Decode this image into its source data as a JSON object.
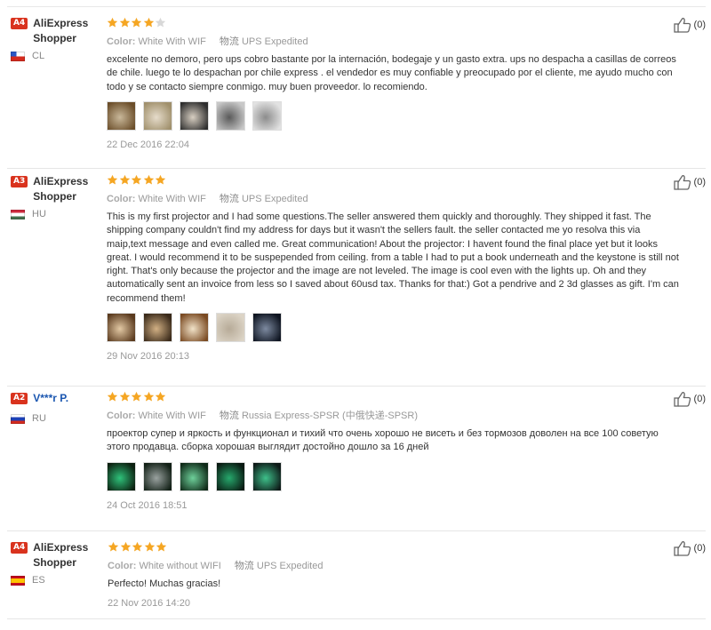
{
  "reviews": [
    {
      "level": "A4",
      "user_name": "AliExpress Shopper",
      "country": "CL",
      "stars": 4,
      "color_label": "Color:",
      "color_value": "White With WIF",
      "shipping_label": "物流",
      "shipping_method": "UPS Expedited",
      "text": "excelente no demoro, pero ups cobro bastante por la internación, bodegaje y un gasto extra. ups no despacha a casillas de correos de chile. luego te lo despachan por chile express . el vendedor es muy confiable y preocupado por el cliente, me ayudo mucho con todo y se contacto siempre conmigo. muy buen proveedor. lo recomiendo.",
      "photos": [
        "photo",
        "photo",
        "photo",
        "photo",
        "photo"
      ],
      "date": "22 Dec 2016 22:04",
      "helpful": "(0)"
    },
    {
      "level": "A3",
      "user_name": "AliExpress Shopper",
      "country": "HU",
      "stars": 5,
      "color_label": "Color:",
      "color_value": "White With WIF",
      "shipping_label": "物流",
      "shipping_method": "UPS Expedited",
      "text": "This is my first projector and I had some questions.The seller answered them quickly and thoroughly. They shipped it fast. The shipping company couldn't find my address for days but it wasn't the sellers fault. the seller contacted me yo resolva this via maip,text message and even called me. Great communication! About the projector: I havent found the final place yet but it looks great. I would recommend it to be suspepended from ceiling. from a table I had to put a book underneath and the keystone is still not right. That's only because the projector and the image are not leveled. The image is cool even with the lights up. Oh and they automatically sent an invoice from less so I saved about 60usd tax. Thanks for that:) Got a pendrive and 2 3d glasses as gift. I'm can recommend them!",
      "photos": [
        "photo",
        "photo",
        "photo",
        "photo",
        "photo"
      ],
      "date": "29 Nov 2016 20:13",
      "helpful": "(0)"
    },
    {
      "level": "A2",
      "user_name": "V***r P.",
      "country": "RU",
      "stars": 5,
      "color_label": "Color:",
      "color_value": "White With WIF",
      "shipping_label": "物流",
      "shipping_method": "Russia Express-SPSR (中俄快递-SPSR)",
      "text": "проектор супер и яркость и функционал и тихий что очень хорошо не висеть и без тормозов доволен на все 100 советую этого продавца. сборка хорошая выглядит достойно дошло за 16 дней",
      "photos": [
        "photo",
        "photo",
        "photo",
        "photo",
        "photo"
      ],
      "date": "24 Oct 2016 18:51",
      "helpful": "(0)"
    },
    {
      "level": "A4",
      "user_name": "AliExpress Shopper",
      "country": "ES",
      "stars": 5,
      "color_label": "Color:",
      "color_value": "White without WIFI",
      "shipping_label": "物流",
      "shipping_method": "UPS Expedited",
      "text": "Perfecto! Muchas gracias!",
      "photos": [],
      "date": "22 Nov 2016 14:20",
      "helpful": "(0)"
    }
  ],
  "colors": {
    "star": "#f5a623",
    "star_empty": "#d8d8d8",
    "badge": "#d9331e",
    "link_name": "#1a56b0"
  }
}
